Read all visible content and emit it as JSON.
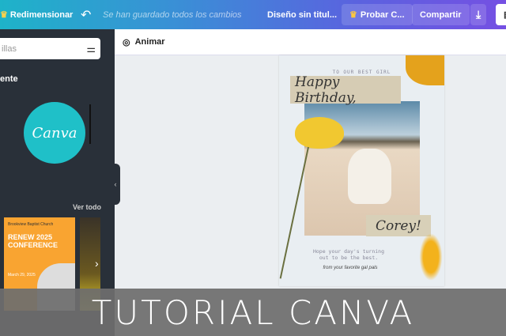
{
  "topbar": {
    "resize": "Redimensionar",
    "saved": "Se han guardado todos los cambios",
    "title": "Diseño sin titul...",
    "try_pro": "Probar C...",
    "share": "Compartir"
  },
  "sidebar": {
    "search_placeholder": "illas",
    "section": "ente",
    "logo_text": "Canva",
    "see_all": "Ver todo",
    "template1": {
      "org": "Brookview Baptist Church",
      "title": "RENEW 2025 CONFERENCE",
      "date": "March 29, 2025"
    }
  },
  "editor": {
    "animate": "Animar"
  },
  "card": {
    "kicker": "TO OUR BEST GIRL",
    "headline": "Happy Birthday,",
    "name": "Corey!",
    "message": "Hope your day's turning out to be the best.",
    "signature": "from your favorite gal pals"
  },
  "banner": {
    "text": "TUTORIAL CANVA"
  }
}
